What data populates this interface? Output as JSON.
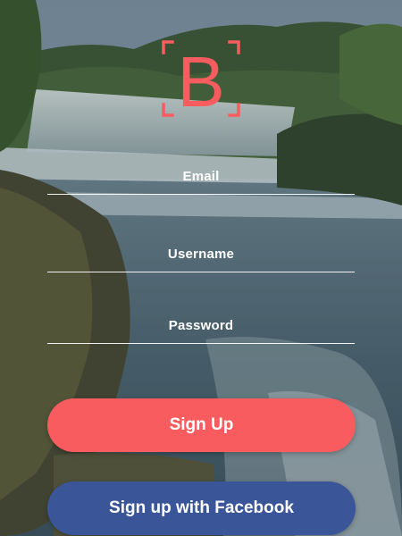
{
  "brand": {
    "logo_letter": "B",
    "accent": "#f95c5e"
  },
  "form": {
    "email_placeholder": "Email",
    "username_placeholder": "Username",
    "password_placeholder": "Password"
  },
  "actions": {
    "signup_label": "Sign Up",
    "facebook_label": "Sign up with Facebook",
    "facebook_color": "#3a5698"
  },
  "background": {
    "scene": "waterfall-river-photo"
  }
}
